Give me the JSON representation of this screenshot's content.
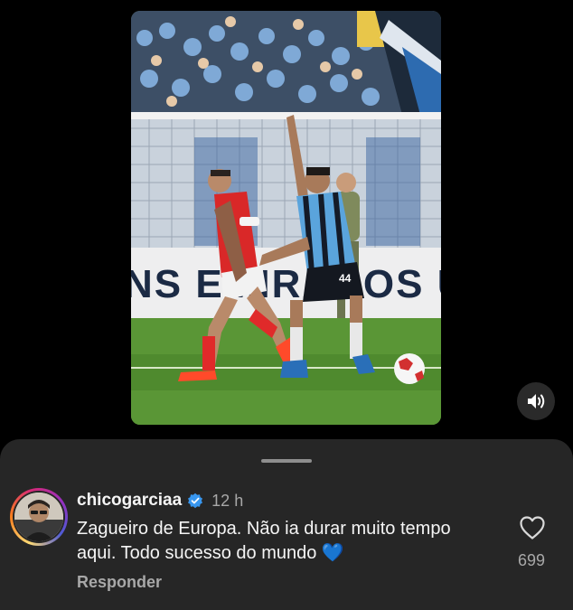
{
  "video": {
    "banner_text": "NS EMIRADOS UNIDOS",
    "jersey_number": "44",
    "sound_icon": "speaker-icon"
  },
  "comment": {
    "username": "chicogarciaa",
    "verified": true,
    "time": "12 h",
    "text": "Zagueiro de Europa. Não ia durar muito tempo aqui. Todo sucesso do mundo 💙",
    "reply_label": "Responder",
    "like_icon": "heart-outline-icon",
    "like_count": "699"
  },
  "colors": {
    "sheet_bg": "#262626",
    "verified_blue": "#3897f0",
    "secondary_text": "#a8a8a8"
  }
}
